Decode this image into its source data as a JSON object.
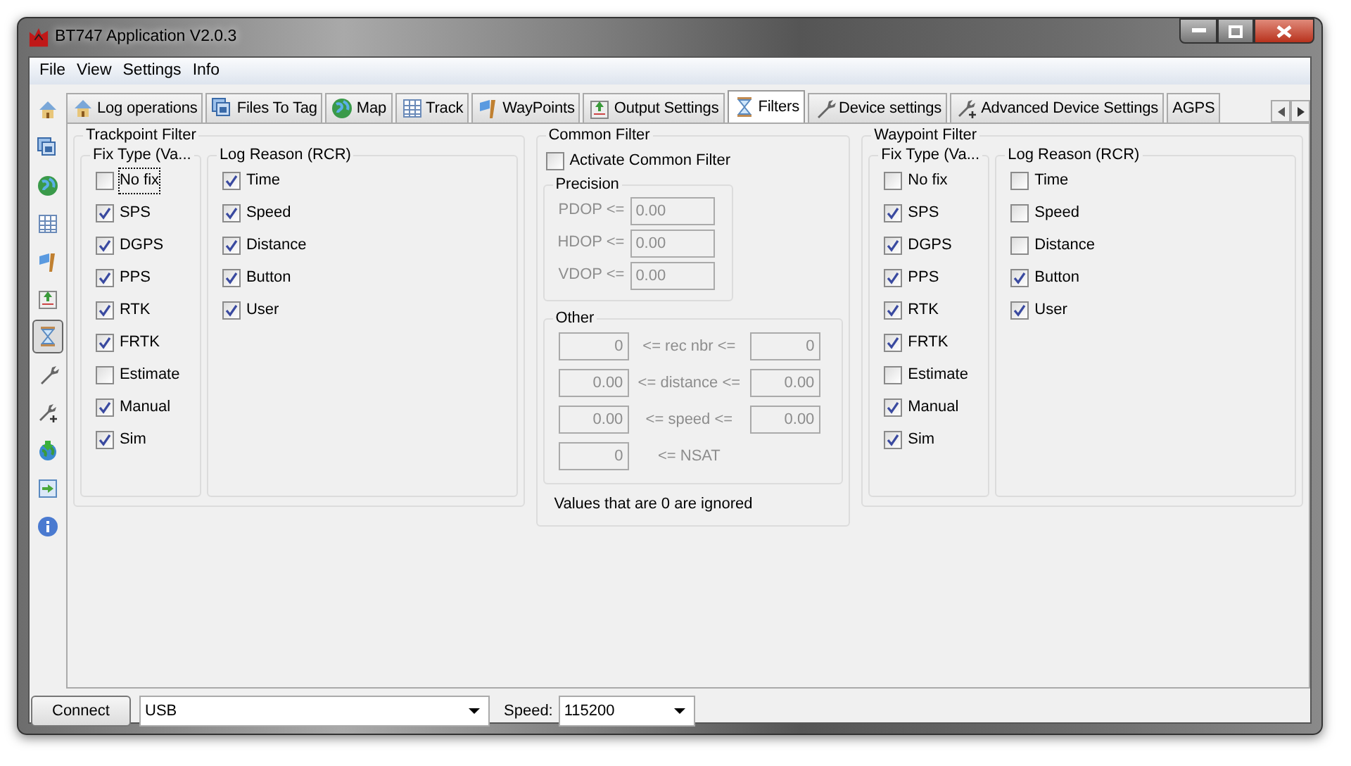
{
  "window": {
    "title": "BT747 Application V2.0.3"
  },
  "menu": [
    "File",
    "View",
    "Settings",
    "Info"
  ],
  "tabs": [
    {
      "label": "Log operations",
      "kind": "home",
      "selected": false
    },
    {
      "label": "Files To Tag",
      "kind": "files",
      "selected": false
    },
    {
      "label": "Map",
      "kind": "globe",
      "selected": false
    },
    {
      "label": "Track",
      "kind": "table",
      "selected": false
    },
    {
      "label": "WayPoints",
      "kind": "flag",
      "selected": false
    },
    {
      "label": "Output Settings",
      "kind": "upload",
      "selected": false
    },
    {
      "label": "Filters",
      "kind": "hourglass",
      "selected": true
    },
    {
      "label": "Device settings",
      "kind": "wrench",
      "selected": false
    },
    {
      "label": "Advanced Device Settings",
      "kind": "wrenchplus",
      "selected": false
    },
    {
      "label": "AGPS",
      "kind": "none",
      "selected": false
    }
  ],
  "toolbar": [
    {
      "kind": "home",
      "selected": false
    },
    {
      "kind": "files",
      "selected": false
    },
    {
      "kind": "globe",
      "selected": false
    },
    {
      "kind": "table",
      "selected": false
    },
    {
      "kind": "flag",
      "selected": false
    },
    {
      "kind": "upload",
      "selected": false
    },
    {
      "kind": "hourglass",
      "selected": true
    },
    {
      "kind": "wrench",
      "selected": false
    },
    {
      "kind": "wrenchplus",
      "selected": false
    },
    {
      "kind": "globearrow",
      "selected": false
    },
    {
      "kind": "docarrow",
      "selected": false
    },
    {
      "kind": "info",
      "selected": false
    }
  ],
  "trackpoint_filter": {
    "title": "Trackpoint Filter",
    "fix_type": {
      "title": "Fix Type (Va...",
      "items": [
        {
          "label": "No fix",
          "checked": false
        },
        {
          "label": "SPS",
          "checked": true
        },
        {
          "label": "DGPS",
          "checked": true
        },
        {
          "label": "PPS",
          "checked": true
        },
        {
          "label": "RTK",
          "checked": true
        },
        {
          "label": "FRTK",
          "checked": true
        },
        {
          "label": "Estimate",
          "checked": false
        },
        {
          "label": "Manual",
          "checked": true
        },
        {
          "label": "Sim",
          "checked": true
        }
      ]
    },
    "log_reason": {
      "title": "Log Reason (RCR)",
      "items": [
        {
          "label": "Time",
          "checked": true
        },
        {
          "label": "Speed",
          "checked": true
        },
        {
          "label": "Distance",
          "checked": true
        },
        {
          "label": "Button",
          "checked": true
        },
        {
          "label": "User",
          "checked": true
        }
      ]
    }
  },
  "common_filter": {
    "title": "Common Filter",
    "disabled": true,
    "activate": {
      "label": "Activate Common Filter",
      "checked": false
    },
    "precision": {
      "title": "Precision",
      "rows": [
        {
          "label": "PDOP <=",
          "value": "0.00"
        },
        {
          "label": "HDOP <=",
          "value": "0.00"
        },
        {
          "label": "VDOP <=",
          "value": "0.00"
        }
      ]
    },
    "other": {
      "title": "Other",
      "rows": [
        {
          "min": "0",
          "label": "<= rec nbr <=",
          "max": "0"
        },
        {
          "min": "0.00",
          "label": "<= distance <=",
          "max": "0.00"
        },
        {
          "min": "0.00",
          "label": "<= speed <=",
          "max": "0.00"
        },
        {
          "min": "0",
          "label": "<= NSAT"
        }
      ]
    },
    "note": "Values that are 0 are ignored"
  },
  "waypoint_filter": {
    "title": "Waypoint Filter",
    "fix_type": {
      "title": "Fix Type (Va...",
      "items": [
        {
          "label": "No fix",
          "checked": false
        },
        {
          "label": "SPS",
          "checked": true
        },
        {
          "label": "DGPS",
          "checked": true
        },
        {
          "label": "PPS",
          "checked": true
        },
        {
          "label": "RTK",
          "checked": true
        },
        {
          "label": "FRTK",
          "checked": true
        },
        {
          "label": "Estimate",
          "checked": false
        },
        {
          "label": "Manual",
          "checked": true
        },
        {
          "label": "Sim",
          "checked": true
        }
      ]
    },
    "log_reason": {
      "title": "Log Reason (RCR)",
      "items": [
        {
          "label": "Time",
          "checked": false
        },
        {
          "label": "Speed",
          "checked": false
        },
        {
          "label": "Distance",
          "checked": false
        },
        {
          "label": "Button",
          "checked": true
        },
        {
          "label": "User",
          "checked": true
        }
      ]
    }
  },
  "connection": {
    "button": "Connect",
    "port": "USB",
    "speed_label": "Speed:",
    "speed": "115200"
  }
}
